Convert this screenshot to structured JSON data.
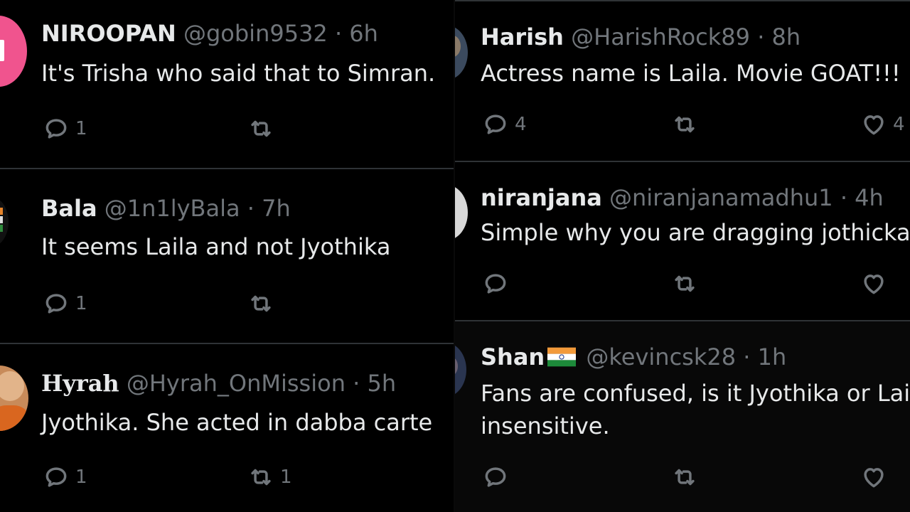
{
  "left_tweets": [
    {
      "name": "NIROOPAN",
      "handle": "@gobin9532",
      "sep": "·",
      "time": "6h",
      "text": "It's Trisha who said that to Simran.",
      "replies": "1",
      "retweets": ""
    },
    {
      "name": "Bala",
      "handle": "@1n1lyBala",
      "sep": "·",
      "time": "7h",
      "text": "It seems Laila and not Jyothika",
      "replies": "1",
      "retweets": ""
    },
    {
      "name": "Hyrah",
      "handle": "@Hyrah_OnMission",
      "sep": "·",
      "time": "5h",
      "text": "Jyothika. She acted in dabba carte",
      "replies": "1",
      "retweets": "1"
    }
  ],
  "right_tweets": [
    {
      "name": "Harish",
      "handle": "@HarishRock89",
      "sep": "·",
      "time": "8h",
      "text": "Actress name is Laila. Movie GOAT!!!",
      "replies": "4",
      "retweets": "",
      "likes": "4"
    },
    {
      "name": "niranjana",
      "handle": "@niranjanamadhu1",
      "sep": "·",
      "time": "4h",
      "text": "Simple why you are dragging jothicka h",
      "replies": "",
      "retweets": "",
      "likes": ""
    },
    {
      "name": "Shan",
      "handle": "@kevincsk28",
      "sep": "·",
      "time": "1h",
      "text": "Fans are confused, is it Jyothika or Laila",
      "text2": "insensitive.",
      "replies": "",
      "retweets": "",
      "likes": ""
    }
  ],
  "icons": {
    "reply": "reply-icon",
    "retweet": "retweet-icon",
    "like": "heart-icon",
    "flag": "india-flag-icon"
  },
  "colors": {
    "background": "#000000",
    "text": "#e7e9ea",
    "muted": "#71767b",
    "separator": "#2f3336",
    "avatar_pink": "#f0548e"
  }
}
